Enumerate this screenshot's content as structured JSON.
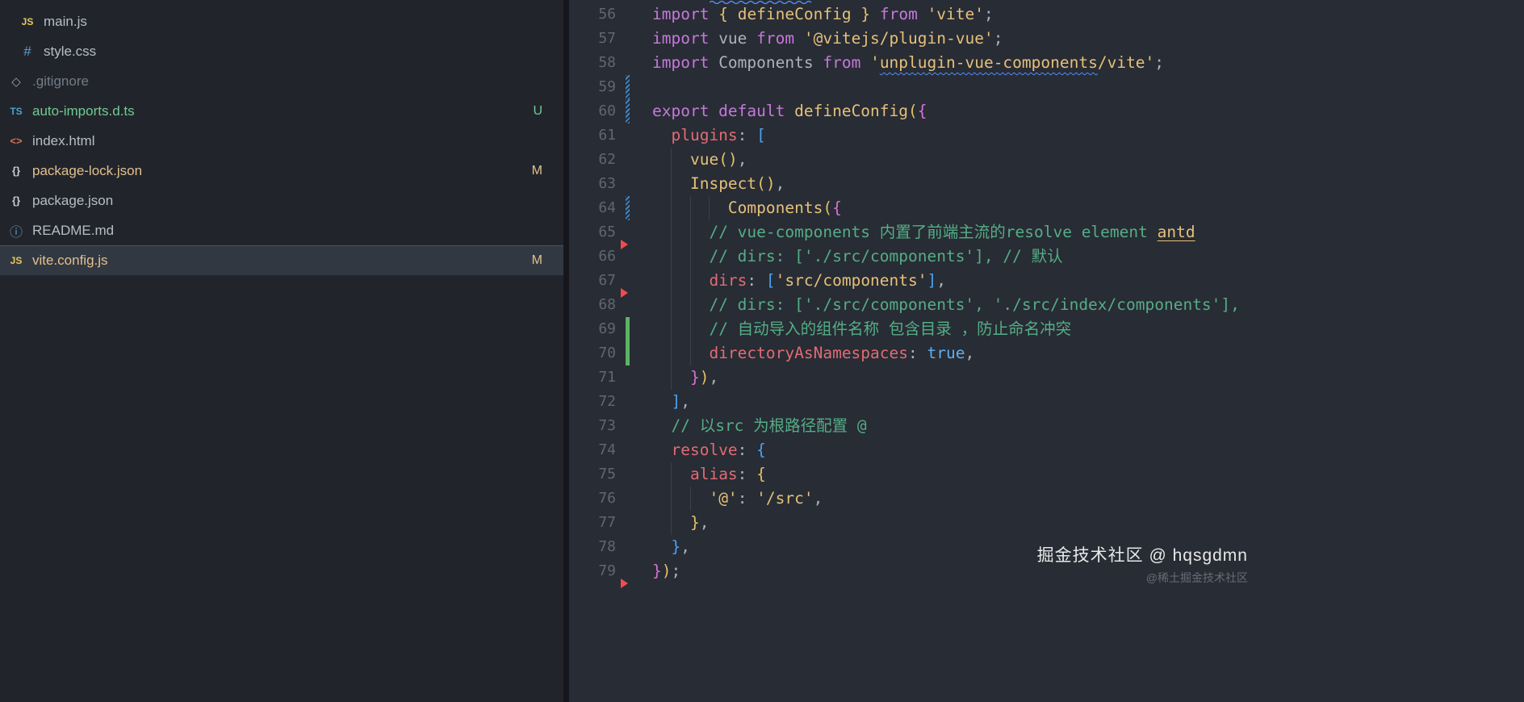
{
  "colors": {
    "editor_bg": "#282c34",
    "sidebar_bg": "#21252b",
    "selected_row_bg": "#323842",
    "keyword": "#c678dd",
    "function": "#e5c07b",
    "string": "#e5c07b",
    "property": "#e06c75",
    "comment": "#55ad87",
    "boolean": "#61afef",
    "line_number": "#5e6773",
    "git_untracked": "#73c991",
    "git_modified": "#e2c08d",
    "gutter_modified": "#3d85c6",
    "gutter_added": "#5bb363",
    "gutter_deleted": "#f14c4c"
  },
  "sidebar": {
    "items": [
      {
        "label": "main.js",
        "icon": "js-file-icon",
        "iconKey": "js",
        "iconGlyph": "JS",
        "indent": 1,
        "state": "normal",
        "badge": ""
      },
      {
        "label": "style.css",
        "icon": "css-file-icon",
        "iconKey": "css",
        "iconGlyph": "#",
        "indent": 1,
        "state": "normal",
        "badge": ""
      },
      {
        "label": ".gitignore",
        "icon": "git-file-icon",
        "iconKey": "git",
        "iconGlyph": "◇",
        "indent": 0,
        "state": "ignored",
        "badge": ""
      },
      {
        "label": "auto-imports.d.ts",
        "icon": "typescript-file-icon",
        "iconKey": "ts",
        "iconGlyph": "TS",
        "indent": 0,
        "state": "untracked",
        "badge": "U"
      },
      {
        "label": "index.html",
        "icon": "html-file-icon",
        "iconKey": "html",
        "iconGlyph": "<>",
        "indent": 0,
        "state": "normal",
        "badge": ""
      },
      {
        "label": "package-lock.json",
        "icon": "json-file-icon",
        "iconKey": "json",
        "iconGlyph": "{}",
        "indent": 0,
        "state": "modified",
        "badge": "M"
      },
      {
        "label": "package.json",
        "icon": "json-file-icon",
        "iconKey": "json",
        "iconGlyph": "{}",
        "indent": 0,
        "state": "normal",
        "badge": ""
      },
      {
        "label": "README.md",
        "icon": "info-file-icon",
        "iconKey": "md",
        "iconGlyph": "ⓘ",
        "indent": 0,
        "state": "normal",
        "badge": ""
      },
      {
        "label": "vite.config.js",
        "icon": "js-file-icon",
        "iconKey": "js",
        "iconGlyph": "JS",
        "indent": 0,
        "state": "modified",
        "badge": "M",
        "selected": true
      }
    ]
  },
  "editor": {
    "lines": [
      {
        "num": 56,
        "indent": 0,
        "gutter": null,
        "tokens": [
          [
            "kw",
            "import"
          ],
          [
            "plain",
            " "
          ],
          [
            "b1",
            "{"
          ],
          [
            "plain",
            " "
          ],
          [
            "fn",
            "defineConfig"
          ],
          [
            "plain",
            " "
          ],
          [
            "b1",
            "}"
          ],
          [
            "plain",
            " "
          ],
          [
            "kw",
            "from"
          ],
          [
            "plain",
            " "
          ],
          [
            "str",
            "'vite'"
          ],
          [
            "plain",
            ";"
          ]
        ]
      },
      {
        "num": 57,
        "indent": 0,
        "gutter": null,
        "tokens": [
          [
            "kw",
            "import"
          ],
          [
            "plain",
            " vue "
          ],
          [
            "kw",
            "from"
          ],
          [
            "plain",
            " "
          ],
          [
            "str",
            "'@vitejs/plugin-vue'"
          ],
          [
            "plain",
            ";"
          ]
        ]
      },
      {
        "num": 58,
        "indent": 0,
        "gutter": null,
        "tokens": [
          [
            "kw",
            "import"
          ],
          [
            "plain",
            " Components "
          ],
          [
            "kw",
            "from"
          ],
          [
            "plain",
            " "
          ],
          [
            "str",
            "'"
          ],
          [
            "strw",
            "unplugin-vue-components"
          ],
          [
            "str",
            "/vite'"
          ],
          [
            "plain",
            ";"
          ]
        ]
      },
      {
        "num": 59,
        "indent": 0,
        "gutter": "mod",
        "tokens": []
      },
      {
        "num": 60,
        "indent": 0,
        "gutter": "mod",
        "tokens": [
          [
            "kw",
            "export default"
          ],
          [
            "plain",
            " "
          ],
          [
            "fn",
            "defineConfig"
          ],
          [
            "b1",
            "("
          ],
          [
            "b2",
            "{"
          ]
        ]
      },
      {
        "num": 61,
        "indent": 2,
        "gutter": null,
        "tokens": [
          [
            "prop",
            "plugins"
          ],
          [
            "plain",
            ": "
          ],
          [
            "b3",
            "["
          ]
        ]
      },
      {
        "num": 62,
        "indent": 4,
        "gutter": null,
        "tokens": [
          [
            "fn",
            "vue"
          ],
          [
            "b1",
            "()"
          ],
          [
            "plain",
            ","
          ]
        ]
      },
      {
        "num": 63,
        "indent": 4,
        "gutter": null,
        "tokens": [
          [
            "fn",
            "Inspect"
          ],
          [
            "b1",
            "()"
          ],
          [
            "plain",
            ","
          ]
        ]
      },
      {
        "num": 64,
        "indent": 8,
        "gutter": "mod",
        "tokens": [
          [
            "fn",
            "Components"
          ],
          [
            "b1",
            "("
          ],
          [
            "b2",
            "{"
          ]
        ]
      },
      {
        "num": 65,
        "indent": 6,
        "gutter": "del",
        "tokens": [
          [
            "cmt",
            "// vue-components 内置了前端主流的resolve element "
          ],
          [
            "cmtl",
            "antd"
          ]
        ]
      },
      {
        "num": 66,
        "indent": 6,
        "gutter": null,
        "tokens": [
          [
            "cmt",
            "// dirs: ['./src/components'], // 默认"
          ]
        ]
      },
      {
        "num": 67,
        "indent": 6,
        "gutter": "del",
        "tokens": [
          [
            "prop",
            "dirs"
          ],
          [
            "plain",
            ": "
          ],
          [
            "b3",
            "["
          ],
          [
            "str",
            "'src/components'"
          ],
          [
            "b3",
            "]"
          ],
          [
            "plain",
            ","
          ]
        ]
      },
      {
        "num": 68,
        "indent": 6,
        "gutter": null,
        "tokens": [
          [
            "cmt",
            "// dirs: ['./src/components', './src/index/components'],"
          ]
        ]
      },
      {
        "num": 69,
        "indent": 6,
        "gutter": "add",
        "tokens": [
          [
            "cmt",
            "// 自动导入的组件名称 包含目录 ，防止命名冲突"
          ]
        ]
      },
      {
        "num": 70,
        "indent": 6,
        "gutter": "add",
        "tokens": [
          [
            "prop",
            "directoryAsNamespaces"
          ],
          [
            "plain",
            ": "
          ],
          [
            "bool",
            "true"
          ],
          [
            "plain",
            ","
          ]
        ]
      },
      {
        "num": 71,
        "indent": 4,
        "gutter": null,
        "tokens": [
          [
            "b2",
            "}"
          ],
          [
            "b1",
            ")"
          ],
          [
            "plain",
            ","
          ]
        ]
      },
      {
        "num": 72,
        "indent": 2,
        "gutter": null,
        "tokens": [
          [
            "b3",
            "]"
          ],
          [
            "plain",
            ","
          ]
        ]
      },
      {
        "num": 73,
        "indent": 2,
        "gutter": null,
        "tokens": [
          [
            "cmt",
            "// 以src 为根路径配置 @"
          ]
        ]
      },
      {
        "num": 74,
        "indent": 2,
        "gutter": null,
        "tokens": [
          [
            "prop",
            "resolve"
          ],
          [
            "plain",
            ": "
          ],
          [
            "b3",
            "{"
          ]
        ]
      },
      {
        "num": 75,
        "indent": 4,
        "gutter": null,
        "tokens": [
          [
            "prop",
            "alias"
          ],
          [
            "plain",
            ": "
          ],
          [
            "b1",
            "{"
          ]
        ]
      },
      {
        "num": 76,
        "indent": 6,
        "gutter": null,
        "tokens": [
          [
            "str",
            "'@'"
          ],
          [
            "plain",
            ": "
          ],
          [
            "str",
            "'/src'"
          ],
          [
            "plain",
            ","
          ]
        ]
      },
      {
        "num": 77,
        "indent": 4,
        "gutter": null,
        "tokens": [
          [
            "b1",
            "}"
          ],
          [
            "plain",
            ","
          ]
        ]
      },
      {
        "num": 78,
        "indent": 2,
        "gutter": null,
        "tokens": [
          [
            "b3",
            "}"
          ],
          [
            "plain",
            ","
          ]
        ]
      },
      {
        "num": 79,
        "indent": 0,
        "gutter": "del",
        "tokens": [
          [
            "b2",
            "}"
          ],
          [
            "b1",
            ")"
          ],
          [
            "plain",
            ";"
          ]
        ]
      }
    ]
  },
  "watermark": {
    "main": "掘金技术社区 @ hqsgdmn",
    "sub": "@稀土掘金技术社区"
  }
}
